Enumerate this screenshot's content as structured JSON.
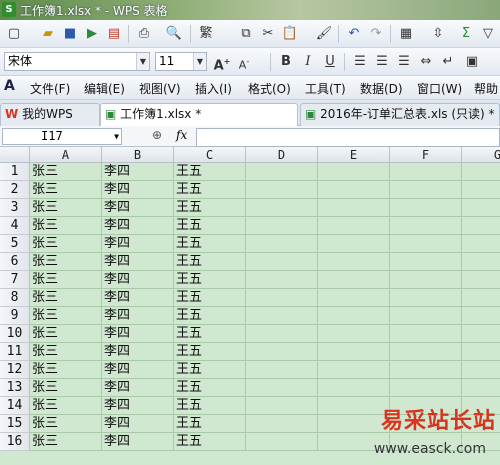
{
  "window": {
    "title": "工作簿1.xlsx * - WPS 表格",
    "app_icon_glyph": "S"
  },
  "font_box": {
    "name": "宋体",
    "size": "11"
  },
  "menu": [
    "文件(F)",
    "编辑(E)",
    "视图(V)",
    "插入(I)",
    "格式(O)",
    "工具(T)",
    "数据(D)",
    "窗口(W)",
    "帮助"
  ],
  "tabs": [
    {
      "label": "我的WPS",
      "icon": "wps-logo-icon"
    },
    {
      "label": "工作簿1.xlsx *",
      "icon": "sheet-icon"
    },
    {
      "label": "2016年-订单汇总表.xls (只读) *",
      "icon": "sheet-icon"
    }
  ],
  "formula_bar": {
    "cell_ref": "I17",
    "fx_label": "fx",
    "value": ""
  },
  "sheet": {
    "columns": [
      "A",
      "B",
      "C",
      "D",
      "E",
      "F",
      "G"
    ],
    "rows": [
      {
        "n": "1",
        "a": "张三",
        "b": "李四",
        "c": "王五"
      },
      {
        "n": "2",
        "a": "张三",
        "b": "李四",
        "c": "王五"
      },
      {
        "n": "3",
        "a": "张三",
        "b": "李四",
        "c": "王五"
      },
      {
        "n": "4",
        "a": "张三",
        "b": "李四",
        "c": "王五"
      },
      {
        "n": "5",
        "a": "张三",
        "b": "李四",
        "c": "王五"
      },
      {
        "n": "6",
        "a": "张三",
        "b": "李四",
        "c": "王五"
      },
      {
        "n": "7",
        "a": "张三",
        "b": "李四",
        "c": "王五"
      },
      {
        "n": "8",
        "a": "张三",
        "b": "李四",
        "c": "王五"
      },
      {
        "n": "9",
        "a": "张三",
        "b": "李四",
        "c": "王五"
      },
      {
        "n": "10",
        "a": "张三",
        "b": "李四",
        "c": "王五"
      },
      {
        "n": "11",
        "a": "张三",
        "b": "李四",
        "c": "王五"
      },
      {
        "n": "12",
        "a": "张三",
        "b": "李四",
        "c": "王五"
      },
      {
        "n": "13",
        "a": "张三",
        "b": "李四",
        "c": "王五"
      },
      {
        "n": "14",
        "a": "张三",
        "b": "李四",
        "c": "王五"
      },
      {
        "n": "15",
        "a": "张三",
        "b": "李四",
        "c": "王五"
      },
      {
        "n": "16",
        "a": "张三",
        "b": "李四",
        "c": "王五"
      }
    ]
  },
  "watermark": {
    "text": "易采站长站",
    "url": "www.easck.com"
  },
  "colors": {
    "cell_bg": "#cfe8cf",
    "title_bar": "#7da066",
    "wps_red": "#d9331f"
  }
}
